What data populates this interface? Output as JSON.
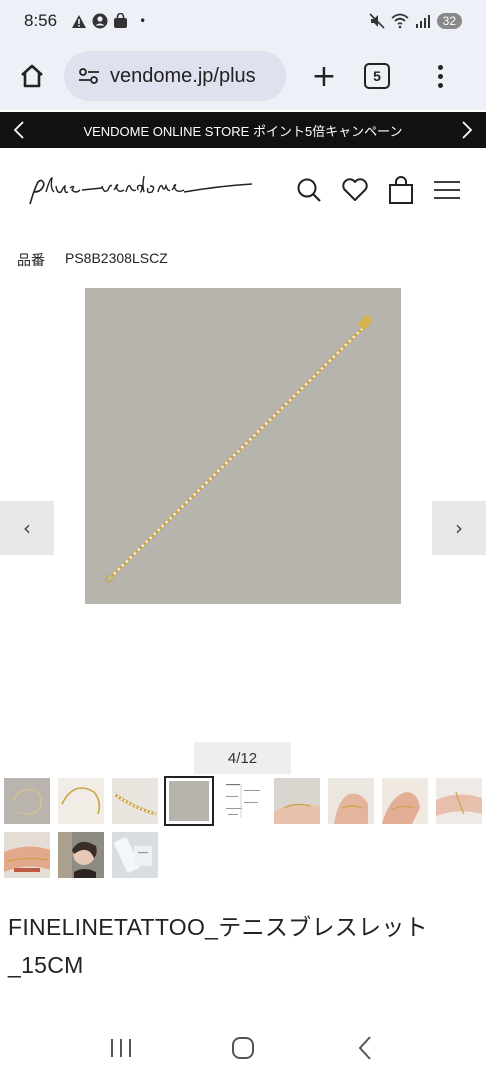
{
  "status_bar": {
    "time": "8:56",
    "dot": "•",
    "battery": "32"
  },
  "browser": {
    "url": "vendome.jp/plus",
    "tab_count": "5",
    "plus": "+"
  },
  "promo": {
    "text": "VENDOME ONLINE STORE ポイント5倍キャンペーン"
  },
  "product": {
    "code_label": "品番",
    "code_value": "PS8B2308LSCZ",
    "pager": "4/12",
    "title": "FINELINETATTOO_テニスブレスレット_15CM"
  },
  "thumbnails": [
    {
      "kind": "bracelet-gray-bg"
    },
    {
      "kind": "bracelet-cream-bg"
    },
    {
      "kind": "bracelet-closeup"
    },
    {
      "kind": "bracelet-plain",
      "selected": true
    },
    {
      "kind": "size-chart"
    },
    {
      "kind": "wrist-model"
    },
    {
      "kind": "hand-model"
    },
    {
      "kind": "hand-model-2"
    },
    {
      "kind": "wrist-model-2"
    },
    {
      "kind": "wrist-model-3"
    },
    {
      "kind": "portrait-model"
    },
    {
      "kind": "packaging"
    }
  ],
  "carousel": {
    "prev_label": "‹",
    "next_label": "›"
  },
  "colors": {
    "promo_bg": "#111111",
    "browser_bg": "#eef0f8",
    "image_bg": "#b7b3ad",
    "gold": "#c9a544"
  }
}
